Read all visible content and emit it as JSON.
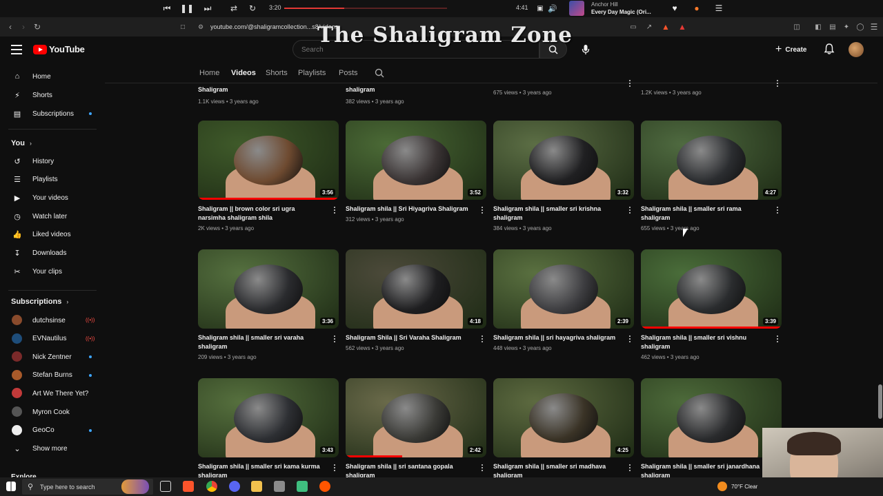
{
  "media": {
    "time_current": "3:20",
    "time_total": "4:41",
    "artist": "Anchor Hill",
    "song": "Every Day Magic (Ori...",
    "progress": 0.37
  },
  "browser": {
    "url": "youtube.com/@shaligramcollection...s8/videos"
  },
  "overlay": {
    "title": "The Shaligram Zone"
  },
  "header": {
    "logo_text": "YouTube",
    "search_placeholder": "Search",
    "create_label": "Create"
  },
  "sidebar": {
    "main": [
      {
        "label": "Home",
        "icon": "home-icon"
      },
      {
        "label": "Shorts",
        "icon": "shorts-icon"
      },
      {
        "label": "Subscriptions",
        "icon": "subscriptions-icon"
      }
    ],
    "you_label": "You",
    "you_items": [
      {
        "label": "History",
        "icon": "history-icon"
      },
      {
        "label": "Playlists",
        "icon": "playlists-icon"
      },
      {
        "label": "Your videos",
        "icon": "your-videos-icon"
      },
      {
        "label": "Watch later",
        "icon": "watch-later-icon"
      },
      {
        "label": "Liked videos",
        "icon": "liked-icon"
      },
      {
        "label": "Downloads",
        "icon": "download-icon"
      },
      {
        "label": "Your clips",
        "icon": "clips-icon"
      }
    ],
    "subscriptions_label": "Subscriptions",
    "subscriptions": [
      {
        "label": "dutchsinse",
        "status": "live",
        "color": "#8a4b2c"
      },
      {
        "label": "EVNautilus",
        "status": "live",
        "color": "#1e4d7a"
      },
      {
        "label": "Nick Zentner",
        "status": "new",
        "color": "#7a2a2a"
      },
      {
        "label": "Stefan Burns",
        "status": "new",
        "color": "#a85a2a"
      },
      {
        "label": "Art We There Yet?",
        "status": "",
        "color": "#c23a3a"
      },
      {
        "label": "Myron Cook",
        "status": "",
        "color": "#555555"
      },
      {
        "label": "GeoCo",
        "status": "new",
        "color": "#eeeeee"
      }
    ],
    "show_more": "Show more",
    "explore_label": "Explore"
  },
  "tabs": [
    "Home",
    "Videos",
    "Shorts",
    "Playlists",
    "Posts"
  ],
  "active_tab": "Videos",
  "top_partial": [
    {
      "title": "Shaligram",
      "meta": "1.1K views • 3 years ago"
    },
    {
      "title": "shaligram",
      "meta": "382 views • 3 years ago"
    },
    {
      "title": "",
      "meta": "675 views • 3 years ago"
    },
    {
      "title": "",
      "meta": "1.2K views • 3 years ago"
    }
  ],
  "videos": [
    {
      "title": "Shaligram || brown color sri ugra narsimha shaligram shila",
      "meta": "2K views • 3 years ago",
      "duration": "3:56",
      "watched": 1.0,
      "stone": "#6e4a30",
      "bg": "#3f5a2a"
    },
    {
      "title": "Shaligram shila || Sri Hiyagriva Shaligram",
      "meta": "312 views • 3 years ago",
      "duration": "3:52",
      "watched": 0.0,
      "stone": "#3a3434",
      "bg": "#4b6a36"
    },
    {
      "title": "Shaligram shila || smaller sri krishna shaligram",
      "meta": "384 views • 3 years ago",
      "duration": "3:32",
      "watched": 0.0,
      "stone": "#202022",
      "bg": "#5c6e45"
    },
    {
      "title": "Shaligram shila || smaller sri rama shaligram",
      "meta": "655 views • 3 years ago",
      "duration": "4:27",
      "watched": 0.0,
      "stone": "#2b2d30",
      "bg": "#4f6a40"
    },
    {
      "title": "Shaligram shila || smaller sri varaha shaligram",
      "meta": "209 views • 3 years ago",
      "duration": "3:36",
      "watched": 0.0,
      "stone": "#2a2b2e",
      "bg": "#55703f"
    },
    {
      "title": "Shaligram Shila || Sri Varaha Shaligram",
      "meta": "562 views • 3 years ago",
      "duration": "4:18",
      "watched": 0.0,
      "stone": "#1e1e20",
      "bg": "#4c4a3a"
    },
    {
      "title": "Shaligram shila || sri hayagriva shaligram",
      "meta": "448 views • 3 years ago",
      "duration": "2:39",
      "watched": 0.0,
      "stone": "#3d3d40",
      "bg": "#5a7040"
    },
    {
      "title": "Shaligram shila || smaller sri vishnu shaligram",
      "meta": "462 views • 3 years ago",
      "duration": "3:39",
      "watched": 1.0,
      "stone": "#2a2c2e",
      "bg": "#4a6d3a"
    },
    {
      "title": "Shaligram shila || smaller sri kama kurma shaligram",
      "meta": "",
      "duration": "3:43",
      "watched": 0.0,
      "stone": "#2d2f33",
      "bg": "#56703e"
    },
    {
      "title": "Shaligram shila || sri santana gopala shaligram",
      "meta": "",
      "duration": "2:42",
      "watched": 0.4,
      "stone": "#3a3a36",
      "bg": "#6a6a4a"
    },
    {
      "title": "Shaligram shila || smaller sri madhava shaligram",
      "meta": "",
      "duration": "4:25",
      "watched": 0.0,
      "stone": "#3a3326",
      "bg": "#5d6a40"
    },
    {
      "title": "Shaligram shila || smaller sri janardhana shaligram",
      "meta": "",
      "duration": "",
      "watched": 0.0,
      "stone": "#2a2b2d",
      "bg": "#4d6a3a"
    }
  ],
  "taskbar": {
    "search_placeholder": "Type here to search",
    "weather": "70°F  Clear"
  }
}
